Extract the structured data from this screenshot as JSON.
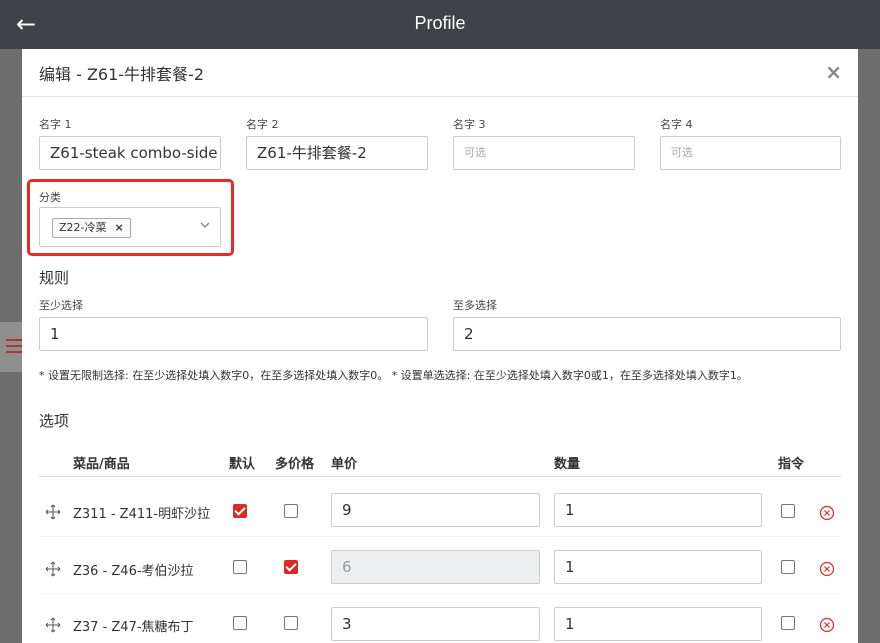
{
  "topbar": {
    "title": "Profile"
  },
  "modal": {
    "title": "编辑 - Z61-牛排套餐-2"
  },
  "names": [
    {
      "label": "名字 1",
      "value": "Z61-steak combo-side",
      "placeholder": ""
    },
    {
      "label": "名字 2",
      "value": "Z61-牛排套餐-2",
      "placeholder": ""
    },
    {
      "label": "名字 3",
      "value": "",
      "placeholder": "可选"
    },
    {
      "label": "名字 4",
      "value": "",
      "placeholder": "可选"
    }
  ],
  "category": {
    "label": "分类",
    "tag": "Z22-冷菜",
    "tag_remove": "×"
  },
  "rules": {
    "heading": "规则",
    "min_label": "至少选择",
    "min_value": "1",
    "max_label": "至多选择",
    "max_value": "2",
    "note": "* 设置无限制选择: 在至少选择处填入数字0，在至多选择处填入数字0。 * 设置单选选择: 在至少选择处填入数字0或1，在至多选择处填入数字1。"
  },
  "options": {
    "heading": "选项",
    "columns": {
      "dish": "菜品/商品",
      "default": "默认",
      "multi_price": "多价格",
      "price": "单价",
      "qty": "数量",
      "command": "指令"
    },
    "rows": [
      {
        "dish": "Z311 - Z411-明虾沙拉",
        "default": true,
        "multi_price": false,
        "price": "9",
        "price_disabled": false,
        "qty": "1",
        "command": false
      },
      {
        "dish": "Z36 - Z46-考伯沙拉",
        "default": false,
        "multi_price": true,
        "price": "6",
        "price_disabled": true,
        "qty": "1",
        "command": false
      },
      {
        "dish": "Z37 - Z47-焦糖布丁",
        "default": false,
        "multi_price": false,
        "price": "3",
        "price_disabled": false,
        "qty": "1",
        "command": false
      }
    ]
  },
  "colors": {
    "accent": "#d92b26",
    "topbar": "#3f4247",
    "highlight": "#e42c27"
  }
}
